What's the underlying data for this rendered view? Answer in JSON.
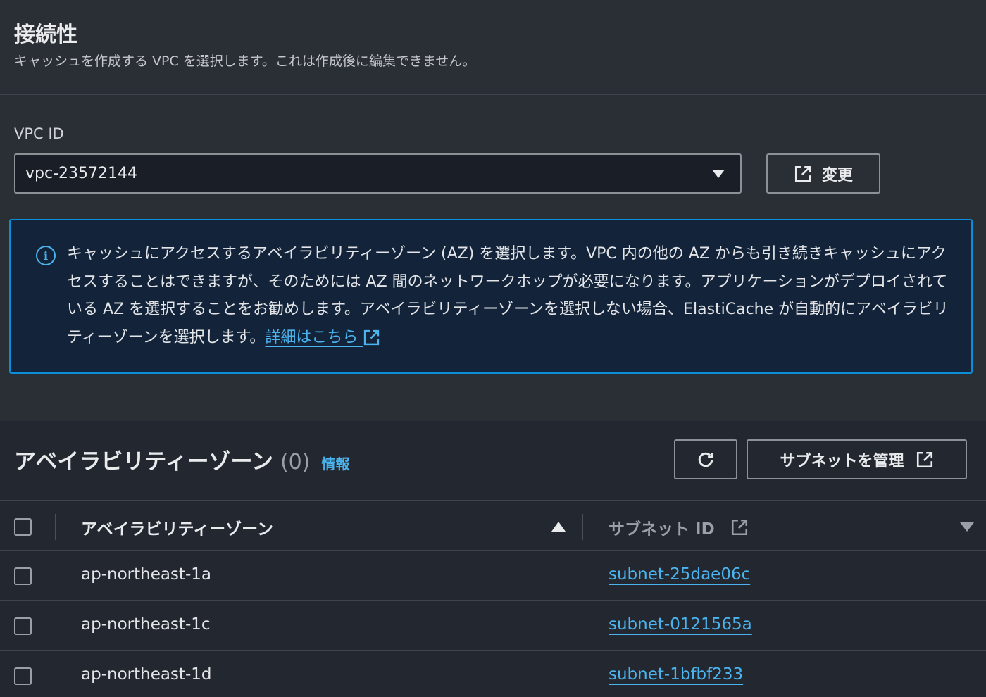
{
  "connectivity": {
    "title": "接続性",
    "description": "キャッシュを作成する VPC を選択します。これは作成後に編集できません。"
  },
  "vpc": {
    "label": "VPC ID",
    "selected": "vpc-23572144",
    "change_label": "変更"
  },
  "info_alert": {
    "text": "キャッシュにアクセスするアベイラビリティーゾーン (AZ) を選択します。VPC 内の他の AZ からも引き続きキャッシュにアクセスすることはできますが、そのためには AZ 間のネットワークホップが必要になります。アプリケーションがデプロイされている AZ を選択することをお勧めします。アベイラビリティーゾーンを選択しない場合、ElastiCache が自動的にアベイラビリティーゾーンを選択します。",
    "link": "詳細はこちら"
  },
  "az_panel": {
    "title": "アベイラビリティーゾーン",
    "count": "(0)",
    "info_link": "情報",
    "manage_subnets_label": "サブネットを管理"
  },
  "table": {
    "headers": {
      "az": "アベイラビリティーゾーン",
      "subnet": "サブネット ID"
    },
    "rows": [
      {
        "az": "ap-northeast-1a",
        "subnet": "subnet-25dae06c"
      },
      {
        "az": "ap-northeast-1c",
        "subnet": "subnet-0121565a"
      },
      {
        "az": "ap-northeast-1d",
        "subnet": "subnet-1bfbf233"
      }
    ]
  },
  "colors": {
    "accent": "#4bb3ee",
    "alert_border": "#0a8ed8",
    "alert_bg": "#13243a",
    "page_bg": "#2a2e35"
  },
  "icons": [
    "info-icon",
    "external-link-icon",
    "refresh-icon",
    "caret-down-icon",
    "sort-ascending-icon",
    "sort-descending-icon"
  ]
}
